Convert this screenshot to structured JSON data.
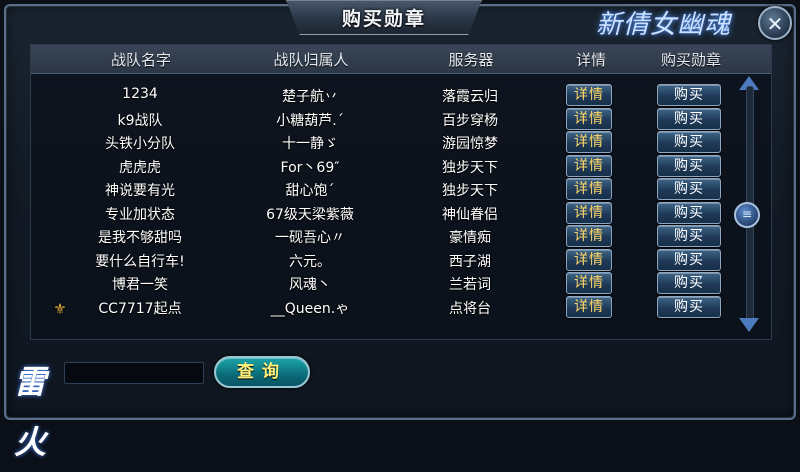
{
  "window": {
    "title": "购买勋章",
    "logo_text": "新倩女幽魂",
    "close_label": "✕"
  },
  "table": {
    "headers": [
      "战队名字",
      "战队归属人",
      "服务器",
      "详情",
      "购买勋章"
    ],
    "rows": [
      {
        "team": "1234",
        "owner": "楚子航丷",
        "server": "落霞云归",
        "detail": "详情",
        "buy": "购买"
      },
      {
        "team": "k9战队",
        "owner": "小糖葫芦.´",
        "server": "百步穿杨",
        "detail": "详情",
        "buy": "购买"
      },
      {
        "team": "头铁小分队",
        "owner": "十一静ゞ",
        "server": "游园惊梦",
        "detail": "详情",
        "buy": "购买"
      },
      {
        "team": "虎虎虎",
        "owner": "For丶69″",
        "server": "独步天下",
        "detail": "详情",
        "buy": "购买"
      },
      {
        "team": "神说要有光",
        "owner": "甜心饱´",
        "server": "独步天下",
        "detail": "详情",
        "buy": "购买"
      },
      {
        "team": "专业加状态",
        "owner": "67级天梁紫薇",
        "server": "神仙眷侣",
        "detail": "详情",
        "buy": "购买"
      },
      {
        "team": "是我不够甜吗",
        "owner": "一砚吾心〃",
        "server": "豪情痴",
        "detail": "详情",
        "buy": "购买"
      },
      {
        "team": "要什么自行车!",
        "owner": "六元。",
        "server": "西子湖",
        "detail": "详情",
        "buy": "购买"
      },
      {
        "team": "博君一笑",
        "owner": "风魂丶",
        "server": "兰若词",
        "detail": "详情",
        "buy": "购买"
      },
      {
        "team": "CC7717起点",
        "owner": "__Queen.ゃ",
        "server": "点将台",
        "detail": "详情",
        "buy": "购买"
      }
    ]
  },
  "search": {
    "value": "",
    "placeholder": "",
    "button_label": "查询"
  },
  "footer": {
    "game_logo_text": "雷火"
  },
  "icons": {
    "rank": "rank-badge-icon",
    "scroll_thumb_glyph": "≡"
  }
}
